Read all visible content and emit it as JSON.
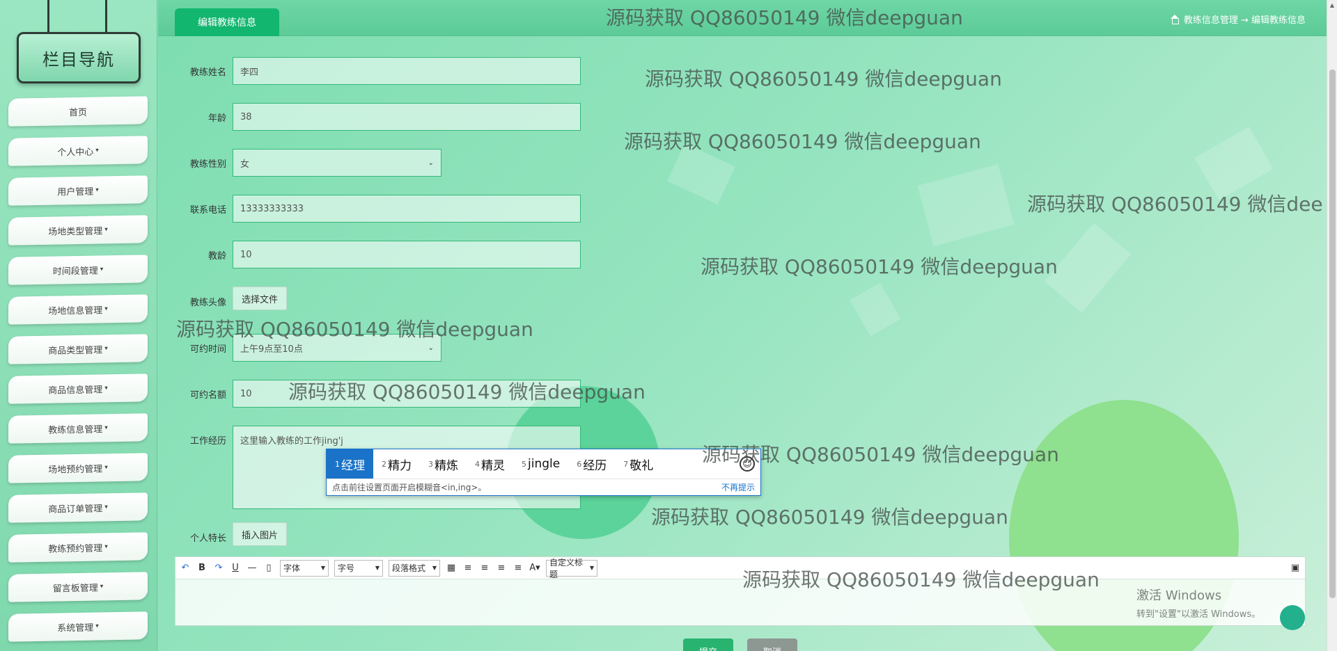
{
  "sidebar": {
    "title": "栏目导航",
    "items": [
      {
        "label": "首页",
        "dropdown": false
      },
      {
        "label": "个人中心",
        "dropdown": true
      },
      {
        "label": "用户管理",
        "dropdown": true
      },
      {
        "label": "场地类型管理",
        "dropdown": true
      },
      {
        "label": "时间段管理",
        "dropdown": true
      },
      {
        "label": "场地信息管理",
        "dropdown": true
      },
      {
        "label": "商品类型管理",
        "dropdown": true
      },
      {
        "label": "商品信息管理",
        "dropdown": true
      },
      {
        "label": "教练信息管理",
        "dropdown": true
      },
      {
        "label": "场地预约管理",
        "dropdown": true
      },
      {
        "label": "商品订单管理",
        "dropdown": true
      },
      {
        "label": "教练预约管理",
        "dropdown": true
      },
      {
        "label": "留言板管理",
        "dropdown": true
      },
      {
        "label": "系统管理",
        "dropdown": true
      }
    ],
    "caret": "▾"
  },
  "header": {
    "active_tab": "编辑教练信息",
    "breadcrumb": "教练信息管理 → 编辑教练信息"
  },
  "form": {
    "name_label": "教练姓名",
    "name_value": "李四",
    "age_label": "年龄",
    "age_value": "38",
    "gender_label": "教练性别",
    "gender_value": "女",
    "phone_label": "联系电话",
    "phone_value": "13333333333",
    "years_label": "教龄",
    "years_value": "10",
    "avatar_label": "教练头像",
    "avatar_button": "选择文件",
    "time_label": "可约时间",
    "time_value": "上午9点至10点",
    "quota_label": "可约名额",
    "quota_value": "10",
    "exp_label": "工作经历",
    "exp_value": "这里输入教练的工作jing'j",
    "specialty_label": "个人特长",
    "specialty_button": "插入图片"
  },
  "ime": {
    "candidates": [
      {
        "num": "1",
        "text": "经理"
      },
      {
        "num": "2",
        "text": "精力"
      },
      {
        "num": "3",
        "text": "精炼"
      },
      {
        "num": "4",
        "text": "精灵"
      },
      {
        "num": "5",
        "text": "jingle"
      },
      {
        "num": "6",
        "text": "经历"
      },
      {
        "num": "7",
        "text": "敬礼"
      }
    ],
    "hint": "点击前往设置页面开启模糊音<in,ing>。",
    "dismiss": "不再提示"
  },
  "editor": {
    "font_select": "字体",
    "size_select": "字号",
    "paragraph_select": "段落格式",
    "custom_title": "自定义标题"
  },
  "actions": {
    "submit": "提交",
    "cancel": "取消"
  },
  "windows": {
    "activate_title": "激活 Windows",
    "activate_hint": "转到\"设置\"以激活 Windows。"
  },
  "watermark": "源码获取 QQ86050149 微信deepguan",
  "watermark_cut": "源码获取 QQ86050149 微信dee",
  "colors": {
    "accent": "#12b66f",
    "ime_blue": "#1a73c8"
  }
}
